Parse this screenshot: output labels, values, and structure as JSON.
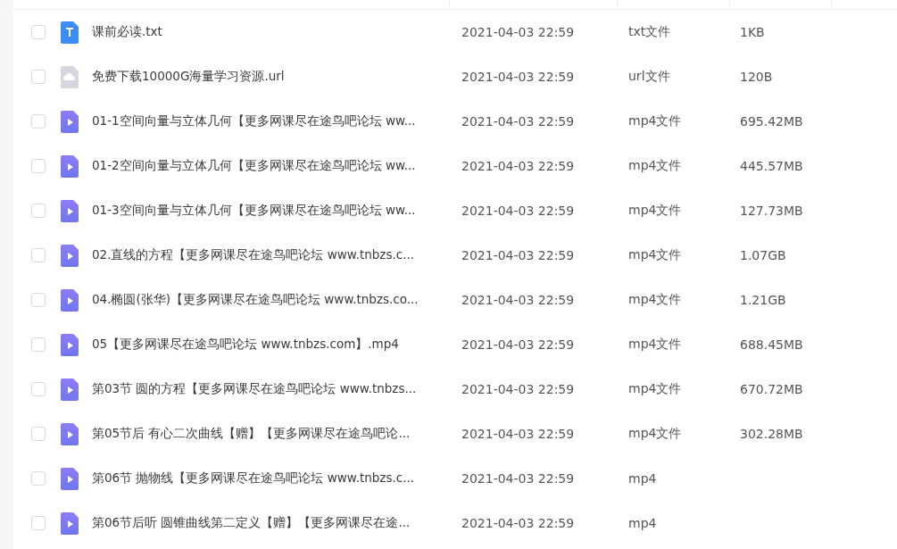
{
  "files": [
    {
      "kind": "txt",
      "name": "课前必读.txt",
      "modified": "2021-04-03 22:59",
      "type": "txt文件",
      "size": "1KB",
      "checked": false
    },
    {
      "kind": "url",
      "name": "免费下载10000G海量学习资源.url",
      "modified": "2021-04-03 22:59",
      "type": "url文件",
      "size": "120B",
      "checked": false
    },
    {
      "kind": "video",
      "name": "01-1空间向量与立体几何【更多网课尽在途鸟吧论坛 ww...",
      "modified": "2021-04-03 22:59",
      "type": "mp4文件",
      "size": "695.42MB",
      "checked": false
    },
    {
      "kind": "video",
      "name": "01-2空间向量与立体几何【更多网课尽在途鸟吧论坛 ww...",
      "modified": "2021-04-03 22:59",
      "type": "mp4文件",
      "size": "445.57MB",
      "checked": false
    },
    {
      "kind": "video",
      "name": "01-3空间向量与立体几何【更多网课尽在途鸟吧论坛 ww...",
      "modified": "2021-04-03 22:59",
      "type": "mp4文件",
      "size": "127.73MB",
      "checked": false
    },
    {
      "kind": "video",
      "name": "02.直线的方程【更多网课尽在途鸟吧论坛 www.tnbzs.c...",
      "modified": "2021-04-03 22:59",
      "type": "mp4文件",
      "size": "1.07GB",
      "checked": false
    },
    {
      "kind": "video",
      "name": "04.椭圆(张华)【更多网课尽在途鸟吧论坛 www.tnbzs.co...",
      "modified": "2021-04-03 22:59",
      "type": "mp4文件",
      "size": "1.21GB",
      "checked": false
    },
    {
      "kind": "video",
      "name": "05【更多网课尽在途鸟吧论坛 www.tnbzs.com】.mp4",
      "modified": "2021-04-03 22:59",
      "type": "mp4文件",
      "size": "688.45MB",
      "checked": false
    },
    {
      "kind": "video",
      "name": "第03节 圆的方程【更多网课尽在途鸟吧论坛 www.tnbzs...",
      "modified": "2021-04-03 22:59",
      "type": "mp4文件",
      "size": "670.72MB",
      "checked": false
    },
    {
      "kind": "video",
      "name": "第05节后 有心二次曲线【赠】【更多网课尽在途鸟吧论...",
      "modified": "2021-04-03 22:59",
      "type": "mp4文件",
      "size": "302.28MB",
      "checked": false
    },
    {
      "kind": "video",
      "name": "第06节 抛物线【更多网课尽在途鸟吧论坛 www.tnbzs.c...",
      "modified": "2021-04-03 22:59",
      "type": "mp4",
      "checked": false
    },
    {
      "kind": "video",
      "name": "第06节后听 圆锥曲线第二定义【赠】【更多网课尽在途...",
      "modified": "2021-04-03 22:59",
      "type": "mp4",
      "checked": false
    }
  ]
}
